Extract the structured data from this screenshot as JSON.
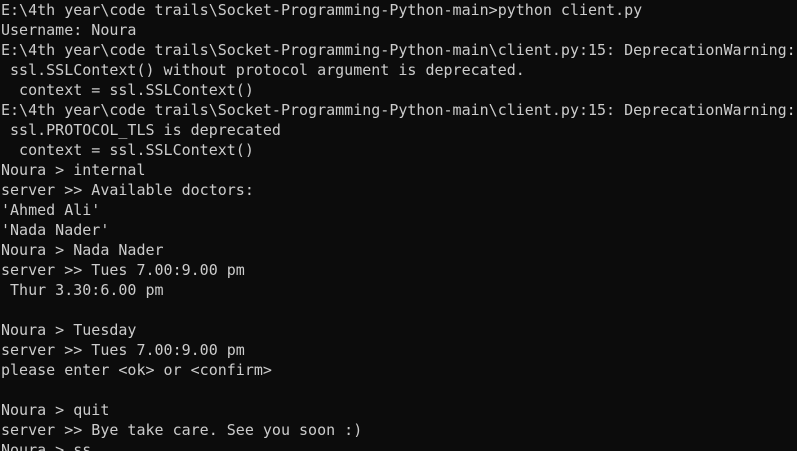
{
  "terminal": {
    "lines": [
      "E:\\4th year\\code trails\\Socket-Programming-Python-main>python client.py",
      "Username: Noura",
      "E:\\4th year\\code trails\\Socket-Programming-Python-main\\client.py:15: DeprecationWarning:",
      " ssl.SSLContext() without protocol argument is deprecated.",
      "  context = ssl.SSLContext()",
      "E:\\4th year\\code trails\\Socket-Programming-Python-main\\client.py:15: DeprecationWarning:",
      " ssl.PROTOCOL_TLS is deprecated",
      "  context = ssl.SSLContext()",
      "Noura > internal",
      "server >> Available doctors:",
      "'Ahmed Ali'",
      "'Nada Nader'",
      "Noura > Nada Nader",
      "server >> Tues 7.00:9.00 pm",
      " Thur 3.30:6.00 pm",
      "",
      "Noura > Tuesday",
      "server >> Tues 7.00:9.00 pm",
      "please enter <ok> or <confirm>",
      "",
      "Noura > quit",
      "server >> Bye take care. See you soon :)",
      "Noura > ss"
    ]
  }
}
